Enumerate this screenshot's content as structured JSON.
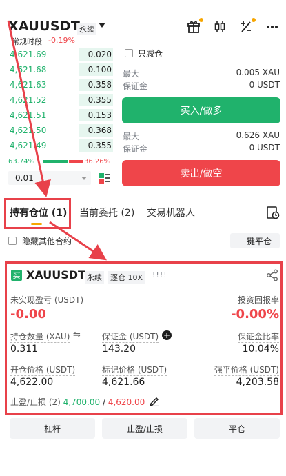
{
  "header": {
    "symbol": "XAUUSDT",
    "contract_tag": "永续",
    "trading_hours": "常规时段",
    "change_pct": "-0.19%"
  },
  "order_book": {
    "bids": [
      {
        "price": "4,621.69",
        "qty": "0.020",
        "depth": 0.32
      },
      {
        "price": "4,621.68",
        "qty": "0.100",
        "depth": 0.32
      },
      {
        "price": "4,621.63",
        "qty": "0.358",
        "depth": 0.32
      },
      {
        "price": "4,621.52",
        "qty": "0.355",
        "depth": 0.32
      },
      {
        "price": "4,621.51",
        "qty": "0.153",
        "depth": 0.32
      },
      {
        "price": "4,621.50",
        "qty": "0.368",
        "depth": 0.32
      },
      {
        "price": "4,621.49",
        "qty": "0.355",
        "depth": 0.32
      }
    ],
    "buy_ratio": "63.74%",
    "sell_ratio": "36.26%",
    "buy_ratio_value": 0.6374,
    "tick_size": "0.01"
  },
  "order_panel": {
    "reduce_only_label": "只减仓",
    "buy": {
      "max_label": "最大",
      "max_value": "0.005 XAU",
      "margin_label": "保证金",
      "margin_value": "0 USDT",
      "button": "买入/做多"
    },
    "sell": {
      "max_label": "最大",
      "max_value": "0.626 XAU",
      "margin_label": "保证金",
      "margin_value": "0 USDT",
      "button": "卖出/做空"
    }
  },
  "tabs": [
    {
      "label": "持有仓位",
      "count": "(1)"
    },
    {
      "label": "当前委托",
      "count": "(2)"
    },
    {
      "label": "交易机器人",
      "count": ""
    }
  ],
  "filters": {
    "hide_other_label": "隐藏其他合约",
    "close_all_label": "一键平仓"
  },
  "position": {
    "side_badge": "买",
    "symbol": "XAUUSDT",
    "contract_tag": "永续",
    "margin_mode": "逐仓 10X",
    "signal": "!!!!",
    "unrealized_pnl_label": "未实现盈亏 (USDT)",
    "unrealized_pnl": "-0.00",
    "roi_label": "投资回报率",
    "roi": "-0.00%",
    "qty_label": "持仓数量 (XAU)",
    "qty": "0.311",
    "margin_label": "保证金 (USDT)",
    "margin": "143.20",
    "margin_ratio_label": "保证金比率",
    "margin_ratio": "10.04%",
    "entry_label": "开仓价格 (USDT)",
    "entry": "4,622.00",
    "mark_label": "标记价格 (USDT)",
    "mark": "4,621.66",
    "liq_label": "强平价格 (USDT)",
    "liq": "4,203.58",
    "tpsl_label": "止盈/止损 (2)",
    "tp": "4,700.00",
    "slash": "/",
    "sl": "4,620.00"
  },
  "bottom_buttons": {
    "leverage": "杠杆",
    "tpsl": "止盈/止损",
    "close": "平仓"
  },
  "colors": {
    "green": "#20b26c",
    "red": "#ef454a",
    "accent": "#f7a600",
    "annotation": "#e8414a"
  }
}
